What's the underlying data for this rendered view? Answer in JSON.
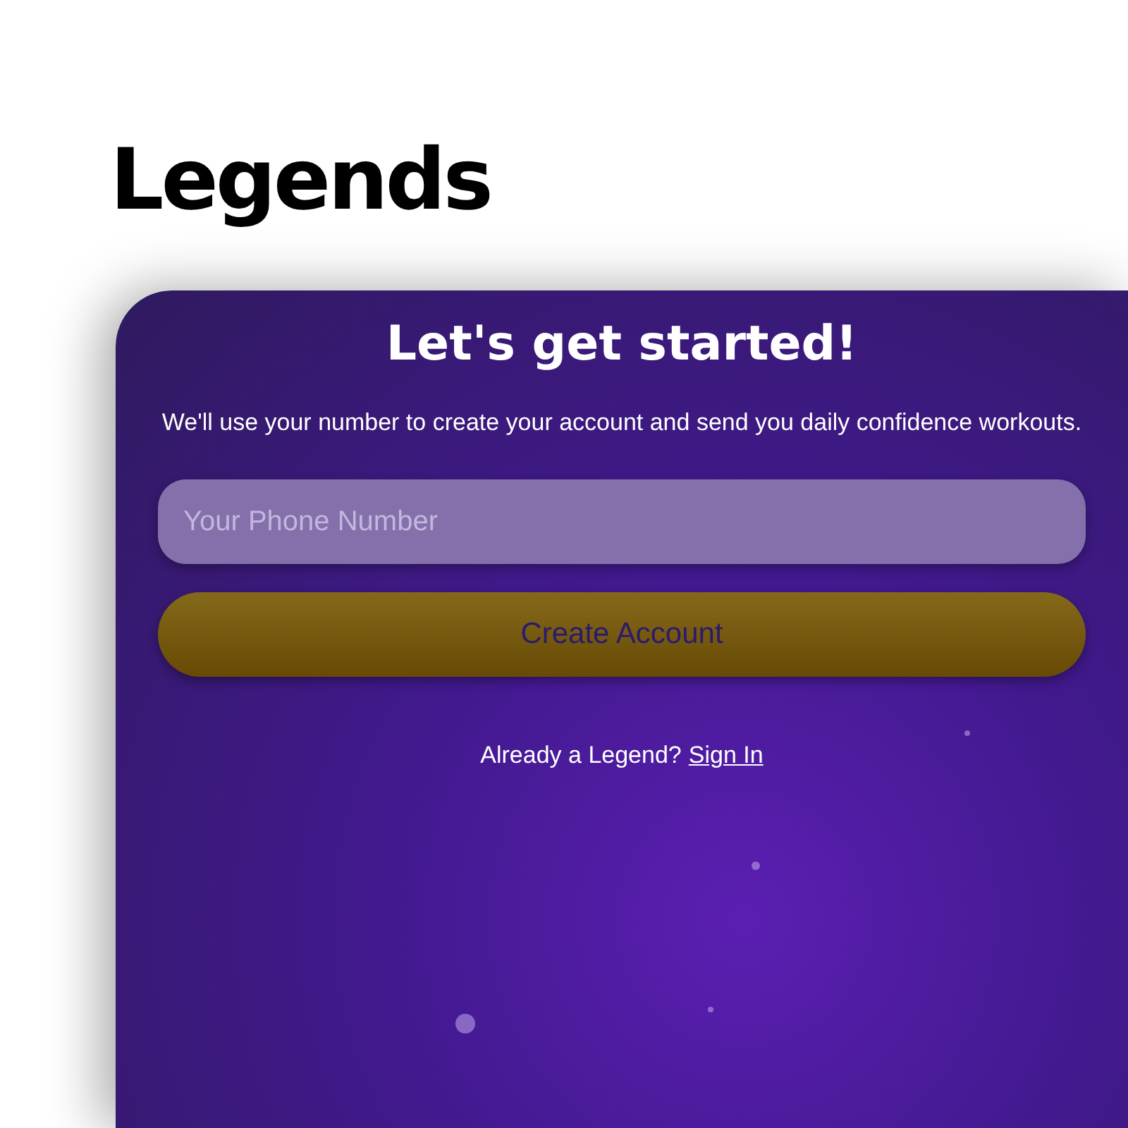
{
  "logo": {
    "text": "Legends"
  },
  "signup_card": {
    "title": "Let's get started!",
    "description": "We'll use your number to create your account and send you daily confidence workouts.",
    "phone_field": {
      "placeholder": "Your Phone Number"
    },
    "create_button": {
      "label": "Create Account"
    },
    "signin_prompt": {
      "text": "Already a Legend?",
      "link": "Sign In"
    }
  }
}
